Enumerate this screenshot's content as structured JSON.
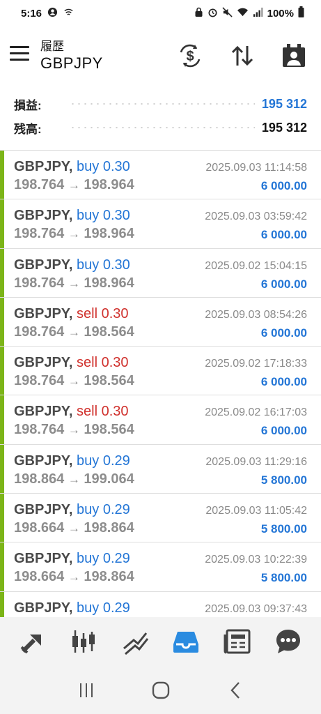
{
  "status_bar": {
    "time": "5:16",
    "battery": "100%",
    "icons": [
      "account-circle-icon",
      "wifi-calling-icon",
      "lock-icon",
      "alarm-icon",
      "mute-icon",
      "wifi-icon",
      "signal-icon",
      "battery-icon"
    ]
  },
  "header": {
    "subtitle": "履歴",
    "title": "GBPJPY",
    "icons": [
      "currency-exchange-icon",
      "sort-icon",
      "calendar-icon",
      "menu-icon"
    ]
  },
  "summary": {
    "profit_label": "損益:",
    "profit_value": "195 312",
    "balance_label": "残高:",
    "balance_value": "195 312",
    "colors": {
      "profit": "#2476d6",
      "balance": "#111111"
    }
  },
  "trades": [
    {
      "symbol": "GBPJPY,",
      "side": "buy",
      "volume": "0.30",
      "open": "198.764",
      "close": "198.964",
      "time": "2025.09.03 11:14:58",
      "profit": "6 000.00"
    },
    {
      "symbol": "GBPJPY,",
      "side": "buy",
      "volume": "0.30",
      "open": "198.764",
      "close": "198.964",
      "time": "2025.09.03 03:59:42",
      "profit": "6 000.00"
    },
    {
      "symbol": "GBPJPY,",
      "side": "buy",
      "volume": "0.30",
      "open": "198.764",
      "close": "198.964",
      "time": "2025.09.02 15:04:15",
      "profit": "6 000.00"
    },
    {
      "symbol": "GBPJPY,",
      "side": "sell",
      "volume": "0.30",
      "open": "198.764",
      "close": "198.564",
      "time": "2025.09.03 08:54:26",
      "profit": "6 000.00"
    },
    {
      "symbol": "GBPJPY,",
      "side": "sell",
      "volume": "0.30",
      "open": "198.764",
      "close": "198.564",
      "time": "2025.09.02 17:18:33",
      "profit": "6 000.00"
    },
    {
      "symbol": "GBPJPY,",
      "side": "sell",
      "volume": "0.30",
      "open": "198.764",
      "close": "198.564",
      "time": "2025.09.02 16:17:03",
      "profit": "6 000.00"
    },
    {
      "symbol": "GBPJPY,",
      "side": "buy",
      "volume": "0.29",
      "open": "198.864",
      "close": "199.064",
      "time": "2025.09.03 11:29:16",
      "profit": "5 800.00"
    },
    {
      "symbol": "GBPJPY,",
      "side": "buy",
      "volume": "0.29",
      "open": "198.664",
      "close": "198.864",
      "time": "2025.09.03 11:05:42",
      "profit": "5 800.00"
    },
    {
      "symbol": "GBPJPY,",
      "side": "buy",
      "volume": "0.29",
      "open": "198.664",
      "close": "198.864",
      "time": "2025.09.03 10:22:39",
      "profit": "5 800.00"
    },
    {
      "symbol": "GBPJPY,",
      "side": "buy",
      "volume": "0.29",
      "open": "",
      "close": "",
      "time": "2025.09.03 09:37:43",
      "profit": ""
    }
  ],
  "arrow": "→",
  "bottom_nav": {
    "items": [
      "trade-icon",
      "chart-candles-icon",
      "trending-icon",
      "history-inbox-icon",
      "news-icon",
      "chat-icon"
    ],
    "active": "history-inbox-icon",
    "active_color": "#2a8be0"
  },
  "system_nav": [
    "recents-icon",
    "home-icon",
    "back-icon"
  ],
  "colors": {
    "accent_bar": "#7cb518",
    "buy": "#2476d6",
    "sell": "#d0312d"
  }
}
